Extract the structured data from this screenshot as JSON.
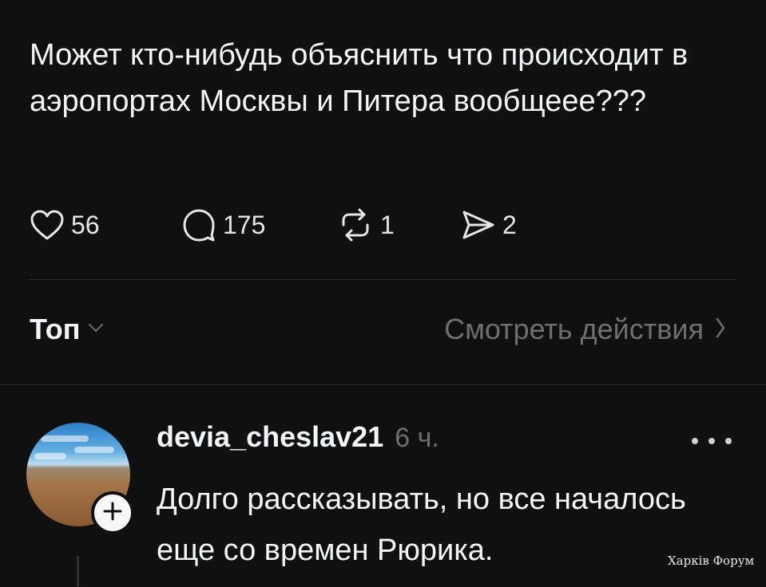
{
  "post": {
    "text": "Может кто-нибудь объяснить что происходит в аэропортах Москвы и Питера вообщеее???"
  },
  "actions": {
    "likes": "56",
    "replies": "175",
    "reposts": "1",
    "shares": "2"
  },
  "sort": {
    "label": "Топ"
  },
  "view_activity": {
    "label": "Смотреть действия"
  },
  "reply": {
    "username": "devia_cheslav21",
    "time": "6 ч.",
    "text": "Долго рассказывать, но все началось еще со времен Рюрика."
  },
  "watermark": {
    "text": "Харків Форум"
  },
  "colors": {
    "background": "#101010",
    "text": "#f3f5f7",
    "muted": "#6e6e6e",
    "divider": "#2b2b2b"
  },
  "icons": [
    "heart-icon",
    "comment-icon",
    "repost-icon",
    "share-icon",
    "chevron-down-icon",
    "chevron-right-icon",
    "plus-icon",
    "more-icon"
  ]
}
